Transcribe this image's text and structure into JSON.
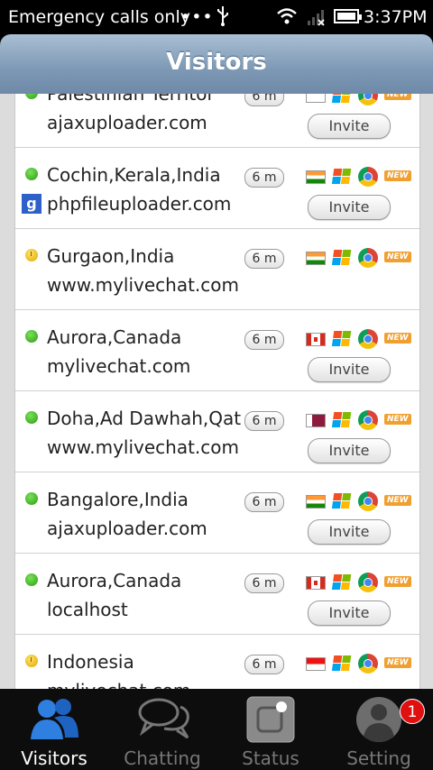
{
  "status_bar": {
    "carrier": "Emergency calls only",
    "dots": "•••",
    "time": "3:37PM",
    "icons": [
      "usb-icon",
      "wifi-icon",
      "no-signal-icon",
      "battery-icon"
    ]
  },
  "header": {
    "title": "Visitors"
  },
  "visitors": [
    {
      "status": "green",
      "location": "Palestinian Territor",
      "site": "ajaxuploader.com",
      "time": "6 m",
      "flag": "ps",
      "referrer": "",
      "new": "NEW",
      "invite": "Invite"
    },
    {
      "status": "green",
      "location": "Cochin,Kerala,India",
      "site": "phpfileuploader.com",
      "time": "6 m",
      "flag": "in",
      "referrer": "google-icon",
      "new": "NEW",
      "invite": "Invite"
    },
    {
      "status": "yellow",
      "location": "Gurgaon,India",
      "site": "www.mylivechat.com",
      "time": "6 m",
      "flag": "in",
      "referrer": "",
      "new": "NEW",
      "invite": ""
    },
    {
      "status": "green",
      "location": "Aurora,Canada",
      "site": "mylivechat.com",
      "time": "6 m",
      "flag": "ca",
      "referrer": "",
      "new": "NEW",
      "invite": "Invite"
    },
    {
      "status": "green",
      "location": "Doha,Ad Dawhah,Qatar",
      "site": "www.mylivechat.com",
      "time": "6 m",
      "flag": "qa",
      "referrer": "",
      "new": "NEW",
      "invite": "Invite"
    },
    {
      "status": "green",
      "location": "Bangalore,India",
      "site": "ajaxuploader.com",
      "time": "6 m",
      "flag": "in",
      "referrer": "",
      "new": "NEW",
      "invite": "Invite"
    },
    {
      "status": "green",
      "location": "Aurora,Canada",
      "site": "localhost",
      "time": "6 m",
      "flag": "ca",
      "referrer": "",
      "new": "NEW",
      "invite": "Invite"
    },
    {
      "status": "yellow",
      "location": "Indonesia",
      "site": "mylivechat.com",
      "time": "6 m",
      "flag": "id",
      "referrer": "",
      "new": "NEW",
      "invite": ""
    }
  ],
  "tabs": [
    {
      "label": "Visitors",
      "icon": "visitors-icon",
      "active": true
    },
    {
      "label": "Chatting",
      "icon": "chat-bubbles-icon",
      "active": false
    },
    {
      "label": "Status",
      "icon": "status-icon",
      "active": false
    },
    {
      "label": "Setting",
      "icon": "avatar-icon",
      "active": false
    }
  ],
  "setting_badge": "1"
}
